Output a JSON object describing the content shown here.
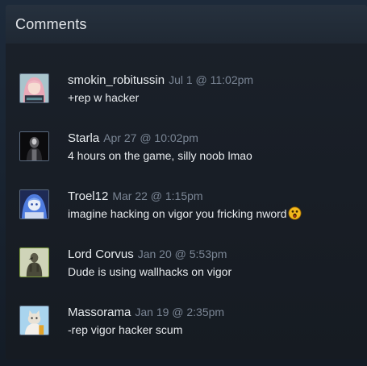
{
  "panel": {
    "title": "Comments"
  },
  "comments": [
    {
      "author": "smokin_robitussin",
      "time": "Jul 1 @ 11:02pm",
      "text": "+rep w hacker",
      "avatar_icon": "anime-girl-avatar"
    },
    {
      "author": "Starla",
      "time": "Apr 27 @ 10:02pm",
      "text": "4 hours on the game, silly noob lmao",
      "avatar_icon": "dark-figure-avatar"
    },
    {
      "author": "Troel12",
      "time": "Mar 22 @ 1:15pm",
      "text": "imagine hacking on vigor you fricking nword",
      "avatar_icon": "blue-anime-avatar",
      "emoji": "surprised-face-emoji"
    },
    {
      "author": "Lord Corvus",
      "time": "Jan 20 @ 5:53pm",
      "text": "Dude is using wallhacks on vigor",
      "avatar_icon": "crow-figure-avatar"
    },
    {
      "author": "Massorama",
      "time": "Jan 19 @ 2:35pm",
      "text": "-rep vigor hacker scum",
      "avatar_icon": "cat-avatar"
    }
  ],
  "colors": {
    "background": "#1b2838",
    "panel": "#181e27",
    "author": "#e8ecef",
    "timestamp": "#7a8594",
    "text": "#e6e9ec"
  }
}
